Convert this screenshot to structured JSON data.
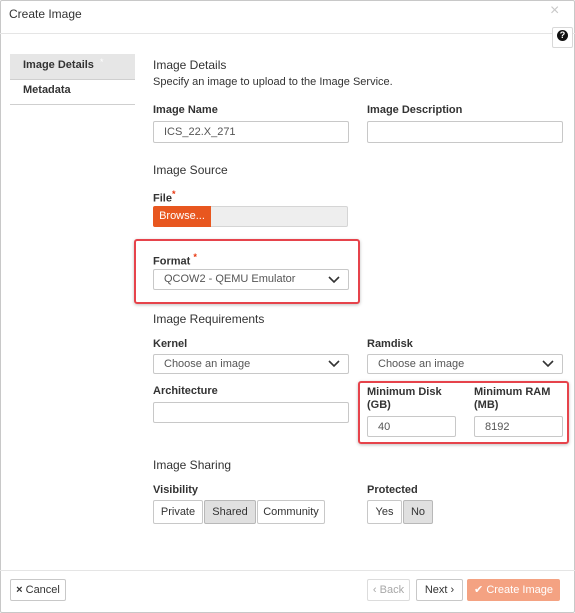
{
  "dialog": {
    "title": "Create Image",
    "close_glyph": "×",
    "help_glyph": "?"
  },
  "nav": {
    "items": [
      {
        "label": "Image Details",
        "required_marker": "*"
      },
      {
        "label": "Metadata"
      }
    ]
  },
  "image_details": {
    "heading": "Image Details",
    "description": "Specify an image to upload to the Image Service.",
    "name_label": "Image Name",
    "name_value": "ICS_22.X_271",
    "desc_label": "Image Description",
    "desc_value": ""
  },
  "image_source": {
    "heading": "Image Source",
    "file_label": "File",
    "required_marker": "*",
    "browse_label": "Browse...",
    "format_label": "Format",
    "format_value": "QCOW2 - QEMU Emulator"
  },
  "requirements": {
    "heading": "Image Requirements",
    "kernel_label": "Kernel",
    "kernel_value": "Choose an image",
    "ramdisk_label": "Ramdisk",
    "ramdisk_value": "Choose an image",
    "arch_label": "Architecture",
    "arch_value": "",
    "min_disk_label_1": "Minimum Disk",
    "min_disk_label_2": "(GB)",
    "min_disk_value": "40",
    "min_ram_label_1": "Minimum RAM",
    "min_ram_label_2": "(MB)",
    "min_ram_value": "8192"
  },
  "sharing": {
    "heading": "Image Sharing",
    "visibility_label": "Visibility",
    "visibility_options": [
      "Private",
      "Shared",
      "Community"
    ],
    "visibility_selected": "Shared",
    "protected_label": "Protected",
    "protected_options": [
      "Yes",
      "No"
    ],
    "protected_selected": "No"
  },
  "footer": {
    "cancel_label": "Cancel",
    "cancel_icon": "×",
    "back_label": "Back",
    "back_icon": "‹",
    "next_label": "Next",
    "next_icon": "›",
    "create_label": "Create Image",
    "create_icon": "✔"
  },
  "colors": {
    "accent": "#e8571f",
    "highlight_box": "#e6434b",
    "primary_button": "#f4a282",
    "required_marker": "#e8360f"
  }
}
